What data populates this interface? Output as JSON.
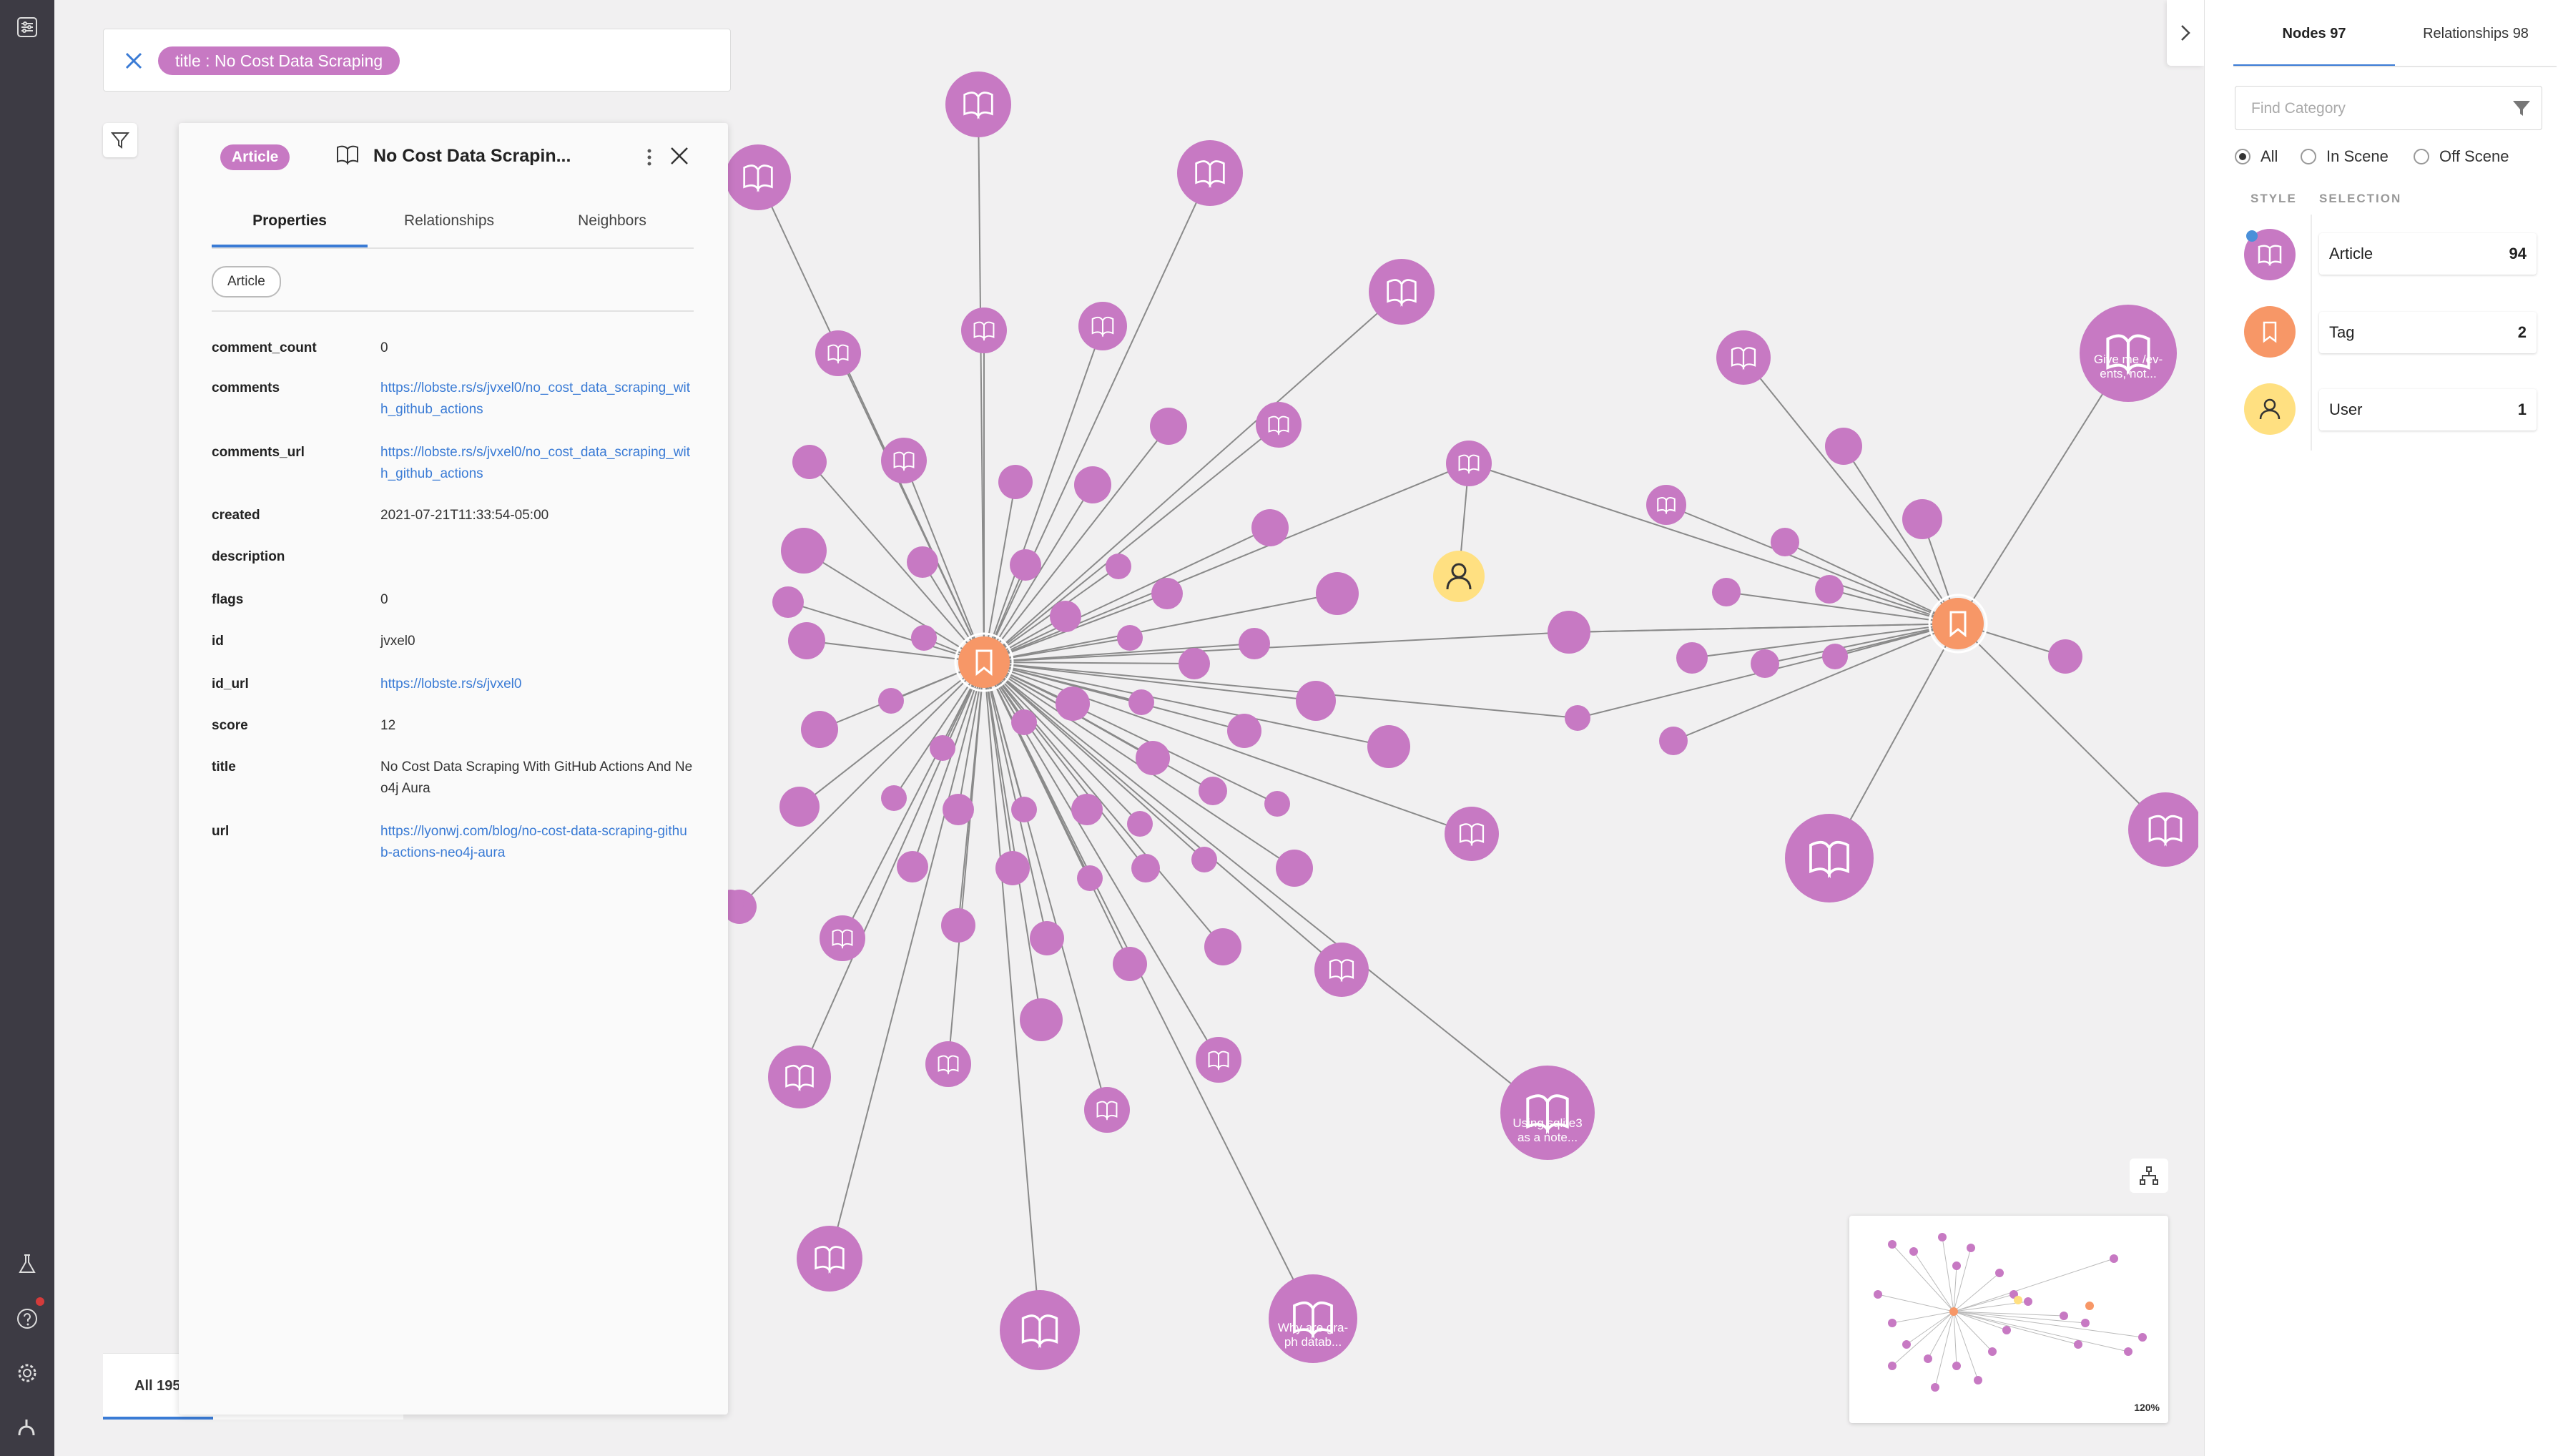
{
  "search": {
    "chip": "title : No Cost Data Scraping"
  },
  "bottom_tab": {
    "label": "All 195"
  },
  "inspector": {
    "label_badge": "Article",
    "title": "No Cost Data Scrapin...",
    "tabs": [
      "Properties",
      "Relationships",
      "Neighbors"
    ],
    "label_chip": "Article",
    "properties": [
      {
        "key": "comment_count",
        "value": "0",
        "link": false
      },
      {
        "key": "comments",
        "value": "https://lobste.rs/s/jvxel0/no_cost_data_scraping_with_github_actions",
        "link": true
      },
      {
        "key": "comments_url",
        "value": "https://lobste.rs/s/jvxel0/no_cost_data_scraping_with_github_actions",
        "link": true
      },
      {
        "key": "created",
        "value": "2021-07-21T11:33:54-05:00",
        "link": false
      },
      {
        "key": "description",
        "value": "",
        "link": false
      },
      {
        "key": "flags",
        "value": "0",
        "link": false
      },
      {
        "key": "id",
        "value": "jvxel0",
        "link": false
      },
      {
        "key": "id_url",
        "value": "https://lobste.rs/s/jvxel0",
        "link": true
      },
      {
        "key": "score",
        "value": "12",
        "link": false
      },
      {
        "key": "title",
        "value": "No Cost Data Scraping With GitHub Actions And Neo4j Aura",
        "link": false
      },
      {
        "key": "url",
        "value": "https://lyonwj.com/blog/no-cost-data-scraping-github-actions-neo4j-aura",
        "link": true
      }
    ]
  },
  "sidebar": {
    "tabs": [
      "Nodes 97",
      "Relationships 98"
    ],
    "find_placeholder": "Find Category",
    "radios": [
      "All",
      "In Scene",
      "Off Scene"
    ],
    "selected_radio": "All",
    "headers": {
      "style": "STYLE",
      "selection": "SELECTION"
    },
    "categories": [
      {
        "name": "Article",
        "count": "94",
        "color": "#c779c3",
        "icon": "book-icon"
      },
      {
        "name": "Tag",
        "count": "2",
        "color": "#f79767",
        "icon": "tag-icon"
      },
      {
        "name": "User",
        "count": "1",
        "color": "#ffe081",
        "icon": "person-icon"
      }
    ]
  },
  "graph_labels": {
    "give_me": [
      "Give me /ev-",
      "ents, not..."
    ],
    "sqlite": [
      "Using sqlite3",
      "as a note..."
    ],
    "graph_db": [
      "Why are gra-",
      "ph datab..."
    ]
  },
  "minimap": {
    "zoom": "120%"
  },
  "colors": {
    "article": "#c779c3",
    "tag": "#f79767",
    "user": "#ffe081",
    "accent": "#3a7bd5"
  }
}
